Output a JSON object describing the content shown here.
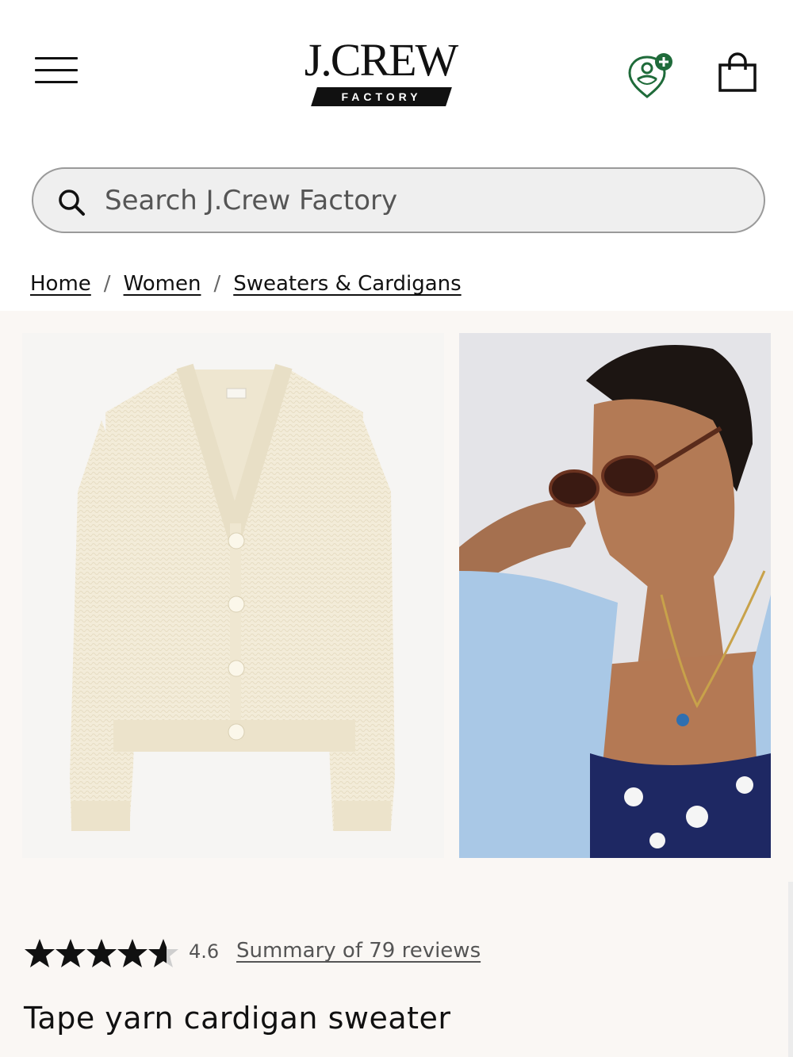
{
  "header": {
    "logo_main": "J.CREW",
    "logo_sub": "FACTORY"
  },
  "search": {
    "placeholder": "Search J.Crew Factory"
  },
  "breadcrumb": {
    "items": [
      "Home",
      "Women",
      "Sweaters & Cardigans"
    ],
    "separator": "/"
  },
  "product": {
    "rating": "4.6",
    "rating_fraction": 0.92,
    "reviews_link": "Summary of 79 reviews",
    "title": "Tape yarn cardigan sweater"
  },
  "colors": {
    "brand_black": "#111111",
    "rewards_green": "#1f6b3a",
    "page_bg": "#faf7f4"
  },
  "icons": {
    "menu": "hamburger-icon",
    "rewards": "rewards-pin-icon",
    "bag": "shopping-bag-icon",
    "search": "search-icon",
    "star": "star-icon"
  }
}
